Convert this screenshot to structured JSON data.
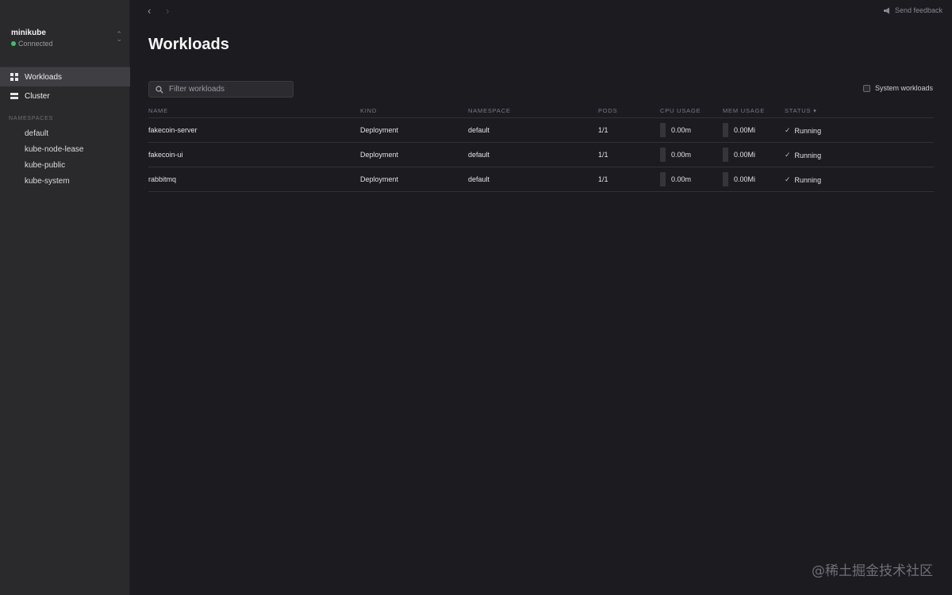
{
  "context": {
    "name": "minikube",
    "status": "Connected",
    "status_color": "#3fbf6b"
  },
  "sidebar": {
    "items": [
      {
        "label": "Workloads",
        "icon": "grid-icon",
        "active": true
      },
      {
        "label": "Cluster",
        "icon": "server-icon",
        "active": false
      }
    ],
    "namespaces_header": "NAMESPACES",
    "namespaces": [
      "default",
      "kube-node-lease",
      "kube-public",
      "kube-system"
    ]
  },
  "header": {
    "feedback_label": "Send feedback"
  },
  "page": {
    "title": "Workloads"
  },
  "filter": {
    "placeholder": "Filter workloads",
    "value": ""
  },
  "system_workloads": {
    "label": "System workloads",
    "checked": false
  },
  "table": {
    "columns": [
      "NAME",
      "KIND",
      "NAMESPACE",
      "PODS",
      "CPU USAGE",
      "MEM USAGE",
      "STATUS"
    ],
    "sort_indicator": "▾",
    "rows": [
      {
        "name": "fakecoin-server",
        "kind": "Deployment",
        "namespace": "default",
        "pods": "1/1",
        "cpu": "0.00m",
        "mem": "0.00Mi",
        "status": "Running"
      },
      {
        "name": "fakecoin-ui",
        "kind": "Deployment",
        "namespace": "default",
        "pods": "1/1",
        "cpu": "0.00m",
        "mem": "0.00Mi",
        "status": "Running"
      },
      {
        "name": "rabbitmq",
        "kind": "Deployment",
        "namespace": "default",
        "pods": "1/1",
        "cpu": "0.00m",
        "mem": "0.00Mi",
        "status": "Running"
      }
    ]
  },
  "watermark": "@稀土掘金技术社区"
}
